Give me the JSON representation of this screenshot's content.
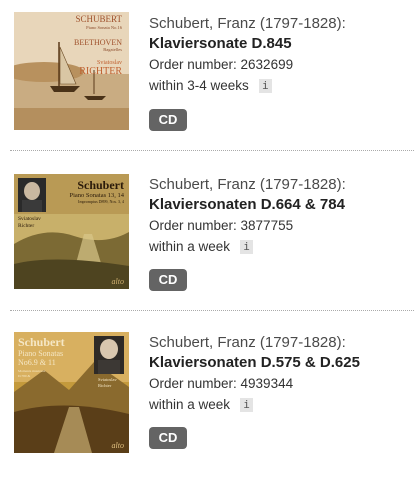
{
  "products": [
    {
      "composer": "Schubert, Franz (1797-1828):",
      "title": "Klaviersonate D.845",
      "order_number": "Order number: 2632699",
      "availability": "within 3-4 weeks",
      "info_symbol": "i",
      "format": "CD",
      "cover": {
        "lines": [
          "SCHUBERT",
          "Piano Sonata No.16",
          "BEETHOVEN",
          "Bagatelles",
          "Sviatoslav",
          "RICHTER"
        ],
        "colors": {
          "sky": "#e6d3b6",
          "water": "#cbb08a",
          "text": "#a0522d"
        }
      }
    },
    {
      "composer": "Schubert, Franz (1797-1828):",
      "title": "Klaviersonaten D.664 & 784",
      "order_number": "Order number: 3877755",
      "availability": "within a week",
      "info_symbol": "i",
      "format": "CD",
      "cover": {
        "lines": [
          "Schubert",
          "Piano Sonatas 13, 14",
          "Impromptus D899, Nos. 3, 4",
          "Sviatoslav",
          "Richter",
          "alto"
        ],
        "colors": {
          "sky": "#c9b16a",
          "land": "#5a5a2a",
          "text": "#2a1a0a"
        }
      }
    },
    {
      "composer": "Schubert, Franz (1797-1828):",
      "title": "Klaviersonaten D.575 & D.625",
      "order_number": "Order number: 4939344",
      "availability": "within a week",
      "info_symbol": "i",
      "format": "CD",
      "cover": {
        "lines": [
          "Schubert",
          "Piano Sonatas",
          "No6.9 & 11",
          "Moments musicaux",
          "D.780 &",
          "Sviatoslav",
          "Richter",
          "alto"
        ],
        "colors": {
          "sky": "#c49a3c",
          "land": "#6b4a1e",
          "text": "#f5e7c5"
        }
      }
    }
  ]
}
